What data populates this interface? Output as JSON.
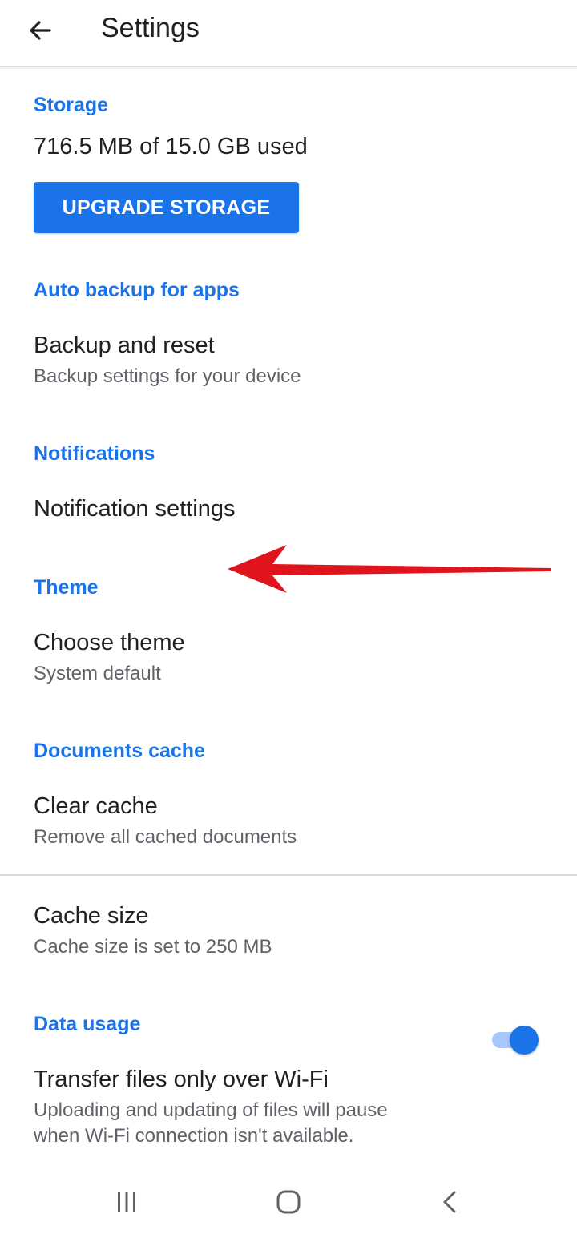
{
  "app_bar": {
    "back_icon": "arrow-left-icon",
    "title": "Settings"
  },
  "storage": {
    "header": "Storage",
    "usage": "716.5 MB of 15.0 GB used",
    "upgrade_label": "UPGRADE STORAGE"
  },
  "auto_backup": {
    "header": "Auto backup for apps",
    "item_title": "Backup and reset",
    "item_subtitle": "Backup settings for your device"
  },
  "notifications": {
    "header": "Notifications",
    "item_title": "Notification settings"
  },
  "theme": {
    "header": "Theme",
    "item_title": "Choose theme",
    "item_subtitle": "System default"
  },
  "documents_cache": {
    "header": "Documents cache",
    "clear_title": "Clear cache",
    "clear_subtitle": "Remove all cached documents",
    "size_title": "Cache size",
    "size_subtitle": "Cache size is set to 250 MB"
  },
  "data_usage": {
    "header": "Data usage",
    "wifi_title": "Transfer files only over Wi-Fi",
    "wifi_subtitle_line1": "Uploading and updating of files will pause",
    "wifi_subtitle_line2": "when Wi-Fi connection isn't available.",
    "wifi_toggle_on": true
  },
  "annotation": {
    "arrow_icon": "red-arrow-pointer-icon",
    "arrow_color": "#e0141c"
  },
  "nav_bar": {
    "recents_icon": "recents-icon",
    "home_icon": "home-icon",
    "back_icon": "back-chevron-icon"
  },
  "colors": {
    "accent": "#1a73e8",
    "primary_text": "#202124",
    "secondary_text": "#5f6368",
    "toggle_track": "#a8c7fa"
  }
}
